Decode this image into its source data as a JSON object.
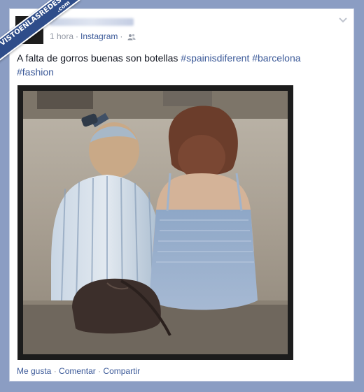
{
  "post": {
    "meta": {
      "time": "1 hora",
      "separator": "·",
      "app": "Instagram",
      "privacy_icon": "friends-icon"
    },
    "message": {
      "text": "A falta de gorros buenas son botellas",
      "hashtags": [
        "#spainisdiferent",
        "#barcelona",
        "#fashion"
      ]
    },
    "actions": {
      "like": "Me gusta",
      "comment": "Comentar",
      "share": "Compartir",
      "separator": "·"
    }
  },
  "watermark": {
    "line1": "VISTOENLASREDES",
    "line2": ".com"
  },
  "colors": {
    "background": "#8b9dc3",
    "link": "#3b5998",
    "meta": "#9197a3",
    "badge": "#2f4d8a"
  }
}
